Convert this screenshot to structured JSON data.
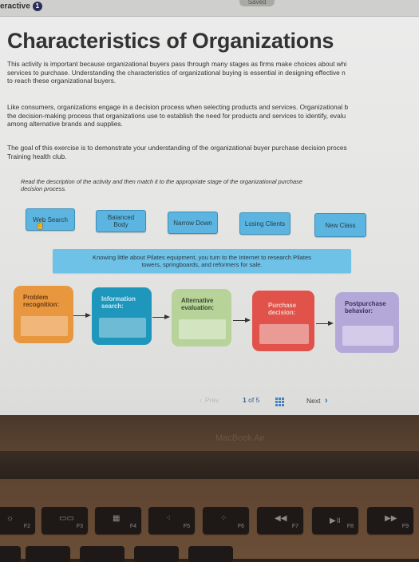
{
  "topbar": {
    "tab_label": "eractive",
    "badge": "1",
    "saved_label": "Saved"
  },
  "page": {
    "title": "Characteristics of Organizations",
    "paragraphs": [
      {
        "lines": [
          "This activity is important because organizational buyers pass through many stages as firms make choices about whi",
          "services to purchase. Understanding the characteristics of organizational buying is essential in designing effective n",
          "to reach these organizational buyers."
        ]
      },
      {
        "lines": [
          "Like consumers, organizations engage in a decision process when selecting products and services. Organizational b",
          "the decision-making process that organizations use to establish the need for products and services to identify, evalu",
          "among alternative brands and supplies."
        ]
      },
      {
        "lines": [
          "The goal of this exercise is to demonstrate your understanding of the organizational buyer purchase decision proces",
          "Training health club."
        ]
      }
    ],
    "instruction": [
      "Read the description of the activity and then match it to the appropriate stage of the organizational purchase",
      "decision process."
    ]
  },
  "chips": [
    {
      "label": "Web Search"
    },
    {
      "label": "Balanced Body"
    },
    {
      "label": "Narrow Down"
    },
    {
      "label": "Losing Clients"
    },
    {
      "label": "New Class"
    }
  ],
  "description": [
    "Knowing little about Pilates equipment, you turn to the Internet to research Pilates",
    "towers, springboards, and reformers for sale."
  ],
  "stages": [
    {
      "line1": "Problem",
      "line2": "recognition:",
      "color": "#e9973f",
      "text_color": "#6b3a10",
      "drop_color": "#f1b77a"
    },
    {
      "line1": "Information",
      "line2": "search:",
      "color": "#1f97bd",
      "text_color": "#cdeaf5",
      "drop_color": "#6dbbd5"
    },
    {
      "line1": "Alternative",
      "line2": "evaluation:",
      "color": "#b7d39a",
      "text_color": "#3a4a2a",
      "drop_color": "#d3e4c1"
    },
    {
      "line1": "Purchase",
      "line2": "decision:",
      "color": "#e0524a",
      "text_color": "#f6d0cc",
      "drop_color": "#ea9b95"
    },
    {
      "line1": "Postpurchase",
      "line2": "behavior:",
      "color": "#b3a8d8",
      "text_color": "#3a3260",
      "drop_color": "#d2cbea"
    }
  ],
  "pager": {
    "prev": "Prev",
    "current": "1",
    "of": "of 5",
    "next": "Next",
    "next_glyph": "›",
    "prev_glyph": "‹"
  },
  "laptop": {
    "brand": "MacBook Air",
    "keys": [
      {
        "glyph": "☼",
        "label": "F2"
      },
      {
        "glyph": "▭▭",
        "label": "F3"
      },
      {
        "glyph": "▦",
        "label": "F4"
      },
      {
        "glyph": "⁖",
        "label": "F5"
      },
      {
        "glyph": "⁘",
        "label": "F6"
      },
      {
        "glyph": "◀◀",
        "label": "F7"
      },
      {
        "glyph": "▶॥",
        "label": "F8"
      },
      {
        "glyph": "▶▶",
        "label": "F9"
      }
    ]
  }
}
